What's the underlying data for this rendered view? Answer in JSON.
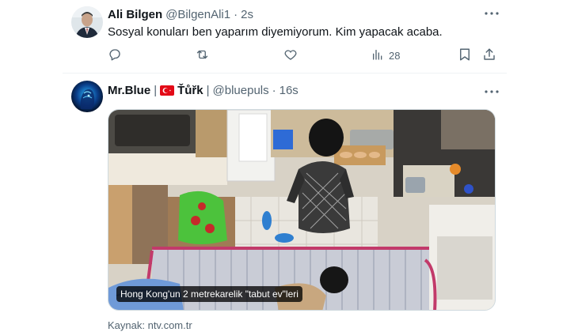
{
  "tweets": [
    {
      "author_name": "Ali Bilgen",
      "handle": "@BilgenAli1",
      "separator": "·",
      "time": "2s",
      "text": "Sosyal konuları ben yaparım diyemiyorum. Kim yapacak acaba.",
      "actions": {
        "reply": "reply-icon",
        "retweet": "retweet-icon",
        "like": "heart-icon",
        "views_icon": "views-icon",
        "views": "28",
        "bookmark": "bookmark-icon",
        "share": "share-icon"
      }
    },
    {
      "author_name": "Mr.Blue",
      "pipe1": "|",
      "flag": "turkey-flag-icon",
      "name_suffix": "Ťůřk",
      "pipe2": "|",
      "handle": "@bluepuls",
      "separator": "·",
      "time": "16s",
      "media": {
        "caption": "Hong Kong'un 2 metrekarelik \"tabut ev\"leri",
        "source": "Kaynak: ntv.com.tr"
      }
    }
  ],
  "colors": {
    "text": "#0f1419",
    "secondary": "#536471",
    "divider": "#eff3f4",
    "flag_red": "#e30a17"
  }
}
